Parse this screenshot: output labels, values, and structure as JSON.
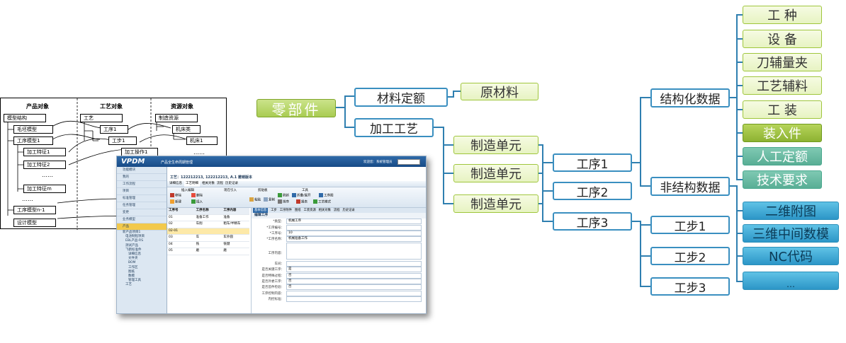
{
  "mindmap": {
    "root": "零部件",
    "level1": [
      "材料定额",
      "加工工艺"
    ],
    "raw_material": "原材料",
    "units": [
      "制造单元",
      "制造单元",
      "制造单元"
    ],
    "processes": [
      "工序1",
      "工序2",
      "工序3"
    ],
    "data_types": [
      "结构化数据",
      "非结构数据"
    ],
    "structured": [
      "工  种",
      "设  备",
      "刀辅量夹",
      "工艺辅料",
      "工  装",
      "装入件",
      "人工定额",
      "技术要求"
    ],
    "steps": [
      "工步1",
      "工步2",
      "工步3"
    ],
    "unstructured": [
      "二维附图",
      "三维中间数模",
      "NC代码",
      "…"
    ]
  },
  "left_diagram": {
    "headers": [
      "产品对象",
      "工艺对象",
      "资源对象"
    ],
    "product": [
      "模型结构",
      "毛坯模型",
      "工序模型1",
      "加工特征1",
      "加工特征2",
      "……",
      "加工特征m",
      "……",
      "工序模型n-1",
      "设计模型"
    ],
    "process": [
      "工艺",
      "工序1",
      "工步1",
      "加工操作1"
    ],
    "resource": [
      "制造资源",
      "机床类",
      "机床1",
      "……"
    ]
  },
  "screenshot": {
    "logo": "VPDM",
    "app_title": "产品全生命周期管理",
    "welcome": "欢迎您：系统管理员",
    "sidebar": [
      "功能模块",
      "我的",
      "工作流程",
      "项目",
      "标准管理",
      "任务管理",
      "变更",
      "业务模型",
      "产品"
    ],
    "tree": [
      "新产品项目1",
      "电池制程项目",
      "EBL产品-RS",
      "测试产品",
      "飞鹤标准件",
      "详细信息",
      "文件夹",
      "BOM",
      "工作区",
      "图纸",
      "数模",
      "管理工具",
      "工艺"
    ],
    "breadcrumb": "工艺：122212213, 122212213, A.1 撤销版本",
    "tabs": [
      "详细信息",
      "工艺明细",
      "相关对象",
      "流程",
      "历史记录"
    ],
    "toolbar_groups": [
      "插入编辑",
      "现在引入",
      "剪贴板",
      "工具"
    ],
    "toolbar_buttons": [
      "移除",
      "删除",
      "新建",
      "插入",
      "粘贴",
      "复制",
      "刷新",
      "折叠/展开",
      "工序图",
      "排序",
      "报表",
      "工艺模式"
    ],
    "grid_headers": [
      "工序号",
      "工序名称",
      "工序内容"
    ],
    "grid_rows": [
      [
        "01",
        "准备工作",
        "准备"
      ],
      [
        "02",
        "车削",
        "粗车/半精车"
      ],
      [
        "02-01",
        "",
        ""
      ],
      [
        "03",
        "车",
        "车外圆"
      ],
      [
        "04",
        "铣",
        "铣键"
      ],
      [
        "05",
        "磨",
        "磨"
      ]
    ],
    "form_tabs": [
      "基本信息",
      "工步",
      "工序附件",
      "图纸",
      "工装资源",
      "相关对象",
      "流程",
      "历史记录"
    ],
    "form_title": "编辑工序",
    "form_fields": [
      [
        "*类型：",
        "机械工序"
      ],
      [
        "*工序编号：",
        ""
      ],
      [
        "*工序号：",
        "10"
      ],
      [
        "*工序名称：",
        "机械准备工作"
      ],
      [
        "工序内容：",
        ""
      ],
      [
        "车间：",
        ""
      ],
      [
        "是否关键工序：",
        "是"
      ],
      [
        "是否特殊过程：",
        "否"
      ],
      [
        "是否外委工序：",
        "否"
      ],
      [
        "是否首件检验：",
        "否"
      ],
      [
        "工序控制内容：",
        ""
      ],
      [
        "内控标准：",
        ""
      ]
    ]
  }
}
